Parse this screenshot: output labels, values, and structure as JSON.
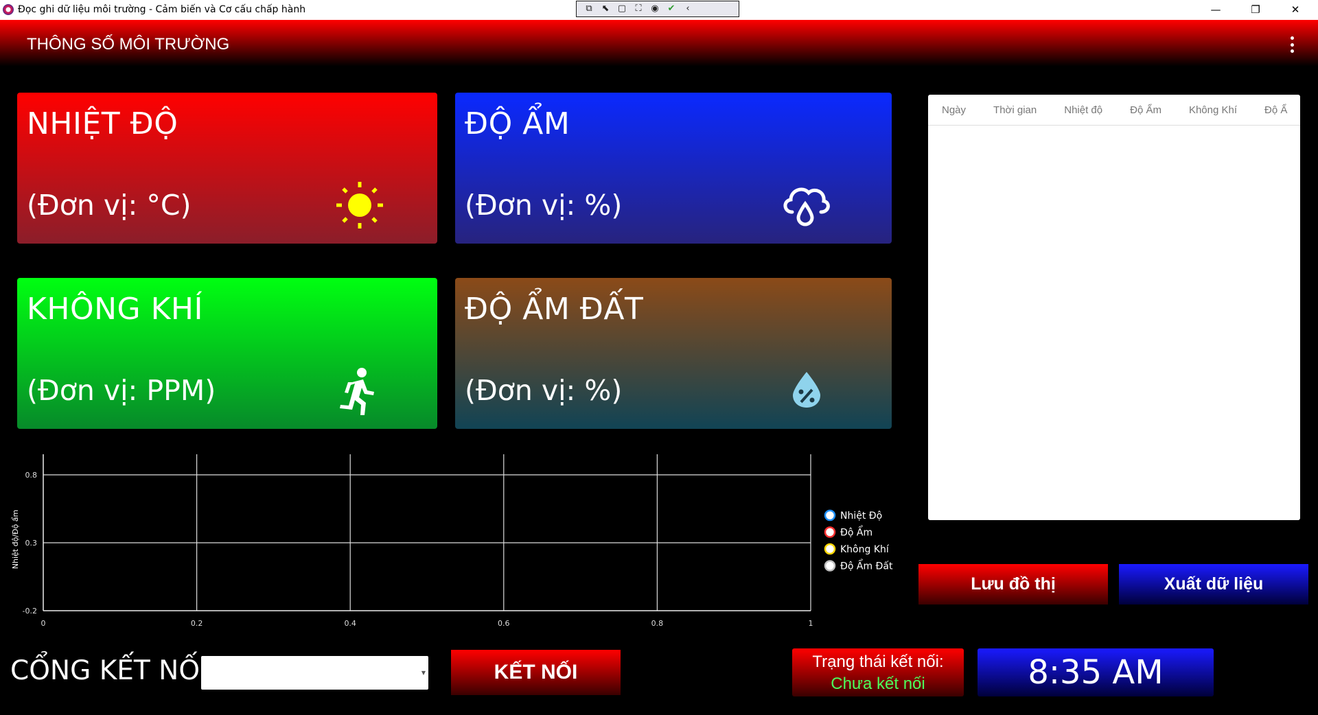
{
  "window": {
    "title": "Đọc ghi dữ liệu môi trường - Cảm biến và Cơ cấu chấp hành",
    "minimize": "—",
    "maximize": "❐",
    "close": "✕"
  },
  "header": {
    "title": "THÔNG SỐ MÔI TRƯỜNG"
  },
  "cards": {
    "temperature": {
      "title": "NHIỆT ĐỘ",
      "unit": "(Đơn vị: °C)",
      "icon": "sun-icon"
    },
    "humidity": {
      "title": "ĐỘ ẨM",
      "unit": "(Đơn vị: %)",
      "icon": "rain-cloud-icon"
    },
    "air": {
      "title": "KHÔNG KHÍ",
      "unit": "(Đơn vị: PPM)",
      "icon": "running-person-icon"
    },
    "soil": {
      "title": "ĐỘ ẨM ĐẤT",
      "unit": "(Đơn vị: %)",
      "icon": "water-percent-icon"
    }
  },
  "table": {
    "columns": [
      "Ngày",
      "Thời gian",
      "Nhiệt độ",
      "Độ Ẩm",
      "Không Khí",
      "Độ Ẩ"
    ],
    "rows": []
  },
  "buttons": {
    "save_chart": "Lưu đồ thị",
    "export_data": "Xuất dữ liệu",
    "connect": "KẾT NỐI"
  },
  "connection": {
    "port_label": "CỔNG KẾT NỐI:",
    "port_value": "",
    "status_label": "Trạng thái kết nối:",
    "status_value": "Chưa kết nối"
  },
  "clock": {
    "time": "8:35 AM"
  },
  "chart_data": {
    "type": "line",
    "ylabel": "Nhiệt độ/Độ ẩm",
    "xlabel": "",
    "xlim": [
      0,
      1
    ],
    "ylim": [
      -0.2,
      0.8
    ],
    "x_ticks": [
      "0",
      "0.2",
      "0.4",
      "0.6",
      "0.8",
      "1"
    ],
    "y_ticks": [
      "-0.2",
      "0.3",
      "0.8"
    ],
    "grid": true,
    "legend_position": "right",
    "series": [
      {
        "name": "Nhiệt Độ",
        "values": [],
        "color": "#1e90ff"
      },
      {
        "name": "Độ Ẩm",
        "values": [],
        "color": "#ff3030"
      },
      {
        "name": "Không Khí",
        "values": [],
        "color": "#ffd700"
      },
      {
        "name": "Độ Ẩm Đất",
        "values": [],
        "color": "#c0c0c0"
      }
    ]
  }
}
